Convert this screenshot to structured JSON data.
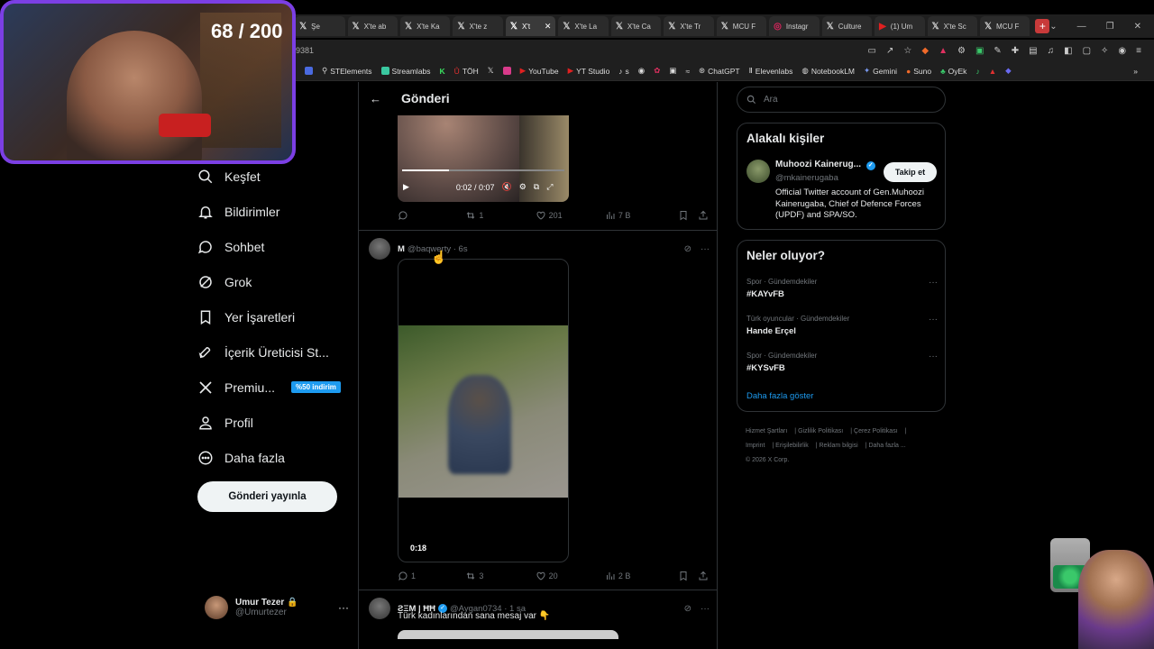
{
  "overlay": {
    "counter": "68 / 200"
  },
  "browser": {
    "tabs": [
      {
        "label": "Şe",
        "icon": "x"
      },
      {
        "label": "X'te ab",
        "icon": "x"
      },
      {
        "label": "X'te Ka",
        "icon": "x"
      },
      {
        "label": "X'te z",
        "icon": "x"
      },
      {
        "label": "X't",
        "icon": "x",
        "active": true
      },
      {
        "label": "X'te La",
        "icon": "x"
      },
      {
        "label": "X'te Ca",
        "icon": "x"
      },
      {
        "label": "X'te Tr",
        "icon": "x"
      },
      {
        "label": "MCU F",
        "icon": "x"
      },
      {
        "label": "Instagr",
        "icon": "instagram"
      },
      {
        "label": "Culture",
        "icon": "x"
      },
      {
        "label": "(1) Um",
        "icon": "youtube"
      },
      {
        "label": "X'te Sc",
        "icon": "x"
      },
      {
        "label": "MCU F",
        "icon": "x"
      }
    ],
    "address": "9381",
    "bookmarks": [
      "STElements",
      "Streamlabs",
      "TÖH",
      "YouTube",
      "YT Studio",
      "s",
      "ChatGPT",
      "Elevenlabs",
      "NotebookLM",
      "Gemini",
      "Suno",
      "OyEk"
    ]
  },
  "nav": {
    "items": [
      {
        "label": "Keşfet",
        "icon": "search-icon"
      },
      {
        "label": "Bildirimler",
        "icon": "bell-icon"
      },
      {
        "label": "Sohbet",
        "icon": "chat-icon"
      },
      {
        "label": "Grok",
        "icon": "grok-icon"
      },
      {
        "label": "Yer İşaretleri",
        "icon": "bookmark-icon"
      },
      {
        "label": "İçerik Üreticisi St...",
        "icon": "rocket-icon"
      },
      {
        "label": "Premiu...",
        "icon": "x-logo-icon",
        "badge": "%50 indirim"
      },
      {
        "label": "Profil",
        "icon": "person-icon"
      },
      {
        "label": "Daha fazla",
        "icon": "more-circle-icon"
      }
    ],
    "post_button": "Gönderi yayınla",
    "account": {
      "name": "Umur Tezer",
      "handle": "@Umurtezer"
    }
  },
  "main": {
    "header_title": "Gönderi",
    "video1": {
      "time": "0:02 / 0:07",
      "progress": 0.29
    },
    "tweet1_actions": {
      "replies": "",
      "reposts": "1",
      "likes": "201",
      "views": "7 B"
    },
    "tweet2": {
      "name": "M",
      "handle": "@baqwerty · 6s",
      "video_time": "0:18",
      "actions": {
        "replies": "1",
        "reposts": "3",
        "likes": "20",
        "views": "2 B"
      }
    },
    "tweet3": {
      "name": "ƧΞM | ĦĦ",
      "handle": "@Aygan0734 · 1 sa",
      "text": "Türk kadınlarından sana mesaj var 👇"
    }
  },
  "sidebar": {
    "search_placeholder": "Ara",
    "related": {
      "title": "Alakalı kişiler",
      "name": "Muhoozi Kainerug...",
      "handle": "@mkainerugaba",
      "follow": "Takip et",
      "bio": "Official Twitter account of Gen.Muhoozi Kainerugaba, Chief of Defence Forces (UPDF) and SPA/SO."
    },
    "trends": {
      "title": "Neler oluyor?",
      "items": [
        {
          "category": "Spor · Gündemdekiler",
          "name": "#KAYvFB"
        },
        {
          "category": "Türk oyuncular · Gündemdekiler",
          "name": "Hande Erçel"
        },
        {
          "category": "Spor · Gündemdekiler",
          "name": "#KYSvFB"
        }
      ],
      "show_more": "Daha fazla göster"
    },
    "footer": {
      "line1": [
        "Hizmet Şartları",
        "Gizlilik Politikası",
        "Çerez Politikası"
      ],
      "line2": [
        "Imprint",
        "Erişilebilirlik",
        "Reklam bilgisi",
        "Daha fazla ..."
      ],
      "copyright": "© 2026 X Corp."
    }
  }
}
